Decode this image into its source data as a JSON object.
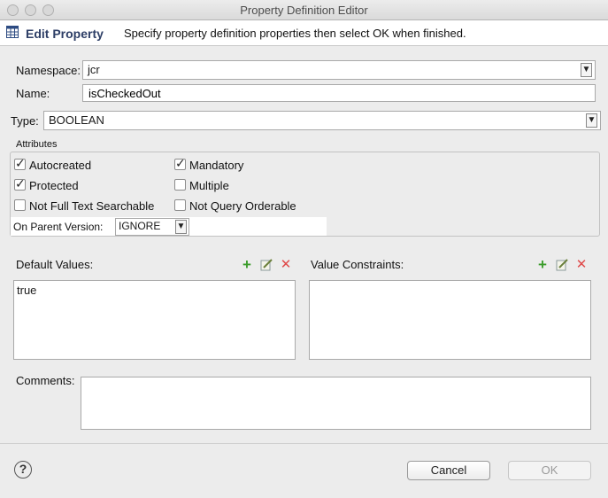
{
  "window": {
    "title": "Property Definition Editor"
  },
  "header": {
    "title": "Edit Property",
    "message": "Specify property definition properties then select OK when finished."
  },
  "form": {
    "namespace": {
      "label": "Namespace:",
      "value": "jcr"
    },
    "name": {
      "label": "Name:",
      "value": "isCheckedOut"
    },
    "type": {
      "label": "Type:",
      "value": "BOOLEAN"
    }
  },
  "attributes": {
    "group_label": "Attributes",
    "autocreated": {
      "label": "Autocreated",
      "checked": true
    },
    "mandatory": {
      "label": "Mandatory",
      "checked": true
    },
    "protected": {
      "label": "Protected",
      "checked": true
    },
    "multiple": {
      "label": "Multiple",
      "checked": false
    },
    "not_full_text_searchable": {
      "label": "Not Full Text Searchable",
      "checked": false
    },
    "not_query_orderable": {
      "label": "Not Query Orderable",
      "checked": false
    },
    "on_parent_version": {
      "label": "On Parent Version:",
      "value": "IGNORE"
    }
  },
  "default_values": {
    "label": "Default Values:",
    "items": [
      "true"
    ]
  },
  "value_constraints": {
    "label": "Value Constraints:",
    "items": []
  },
  "comments": {
    "label": "Comments:",
    "value": ""
  },
  "buttons": {
    "cancel": "Cancel",
    "ok": "OK",
    "help": "?"
  },
  "icons": {
    "header": "grid-icon",
    "add": "plus-icon",
    "edit": "edit-icon",
    "delete": "delete-icon"
  }
}
